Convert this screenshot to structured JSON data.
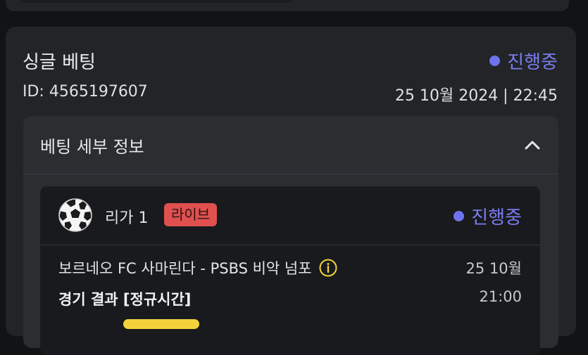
{
  "bet": {
    "title": "싱글 베팅",
    "status": "진행중",
    "id_text": "ID: 4565197607",
    "datetime": "25 10월 2024 | 22:45"
  },
  "details": {
    "title": "베팅 세부 정보",
    "toggle_icon": "chevron-up-icon"
  },
  "match": {
    "sport_icon": "soccer-ball-icon",
    "league": "리가 1",
    "live_label": "라이브",
    "status": "진행중",
    "event": "보르네오 FC 사마린다 - PSBS 비악 넘포",
    "info_icon": "info-icon",
    "date": "25 10월",
    "market": "경기 결과 [정규시간]",
    "time": "21:00"
  },
  "colors": {
    "accent_status": "#7a7df0",
    "live_badge": "#e0504f",
    "highlight": "#f2d33c"
  }
}
